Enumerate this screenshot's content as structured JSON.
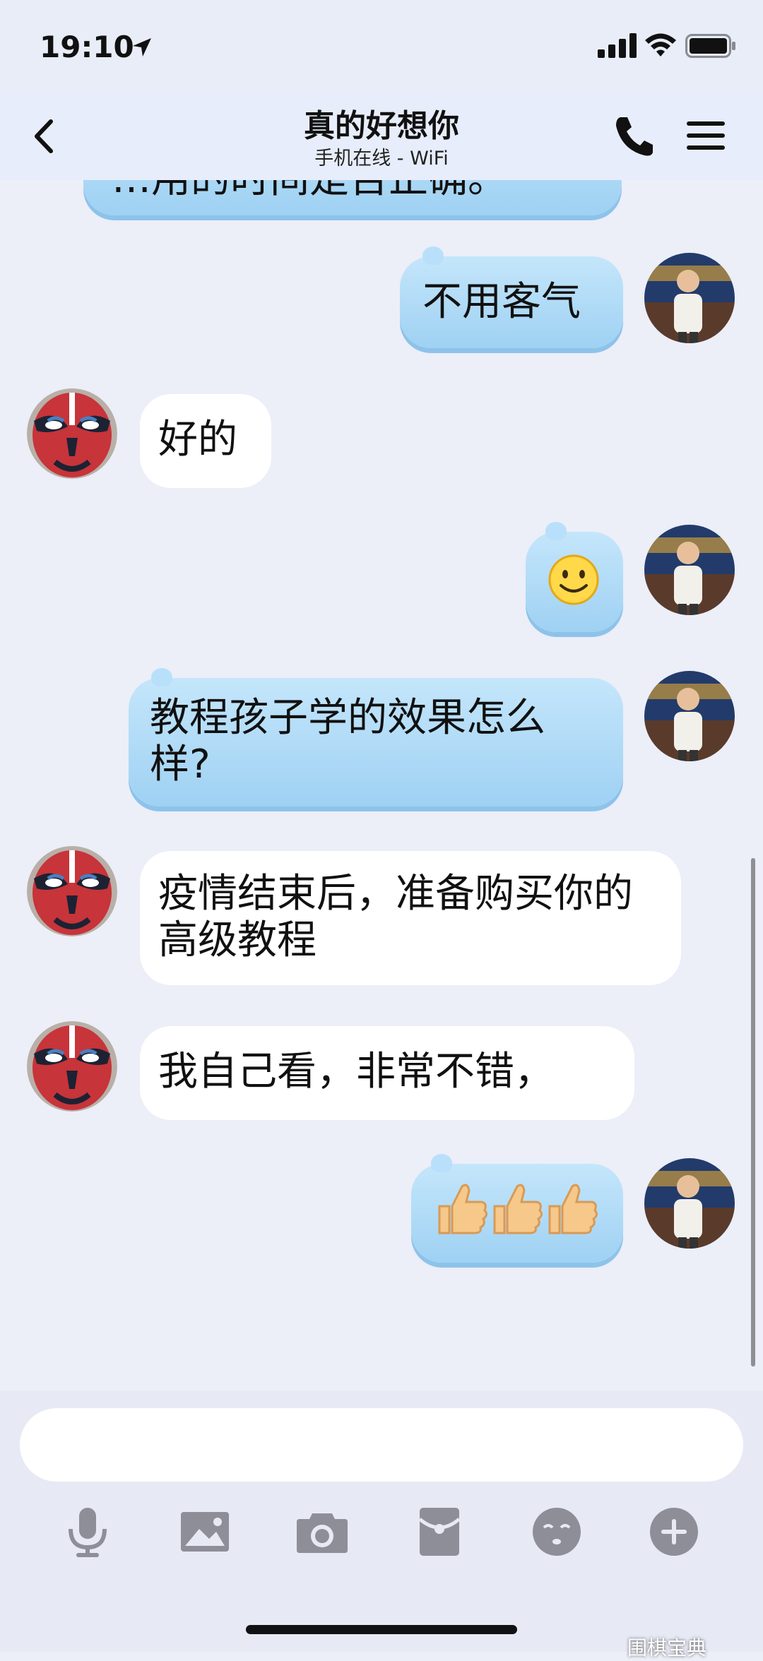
{
  "status_bar": {
    "time": "19:10"
  },
  "header": {
    "title": "真的好想你",
    "subtitle": "手机在线 - WiFi"
  },
  "messages": [
    {
      "side": "right",
      "type": "text",
      "text": "…用的时间是否正确。"
    },
    {
      "side": "right",
      "type": "text",
      "text": "不用客气"
    },
    {
      "side": "left",
      "type": "text",
      "text": "好的"
    },
    {
      "side": "right",
      "type": "emoji",
      "text": "🙂"
    },
    {
      "side": "right",
      "type": "text",
      "text": "教程孩子学的效果怎么样?"
    },
    {
      "side": "left",
      "type": "text",
      "text": "疫情结束后，准备购买你的高级教程"
    },
    {
      "side": "left",
      "type": "text",
      "text": "我自己看，非常不错，"
    },
    {
      "side": "right",
      "type": "emoji",
      "text": "👍👍👍"
    }
  ],
  "toolbar": {
    "icons": [
      "microphone-icon",
      "image-icon",
      "camera-icon",
      "red-packet-icon",
      "emoji-face-icon",
      "plus-icon"
    ]
  },
  "watermark": "围棋宝典",
  "colors": {
    "blue_bubble": "#a9d6f5",
    "white_bubble": "#ffffff",
    "background": "#eceef8",
    "icon_gray": "#8e8e99"
  }
}
